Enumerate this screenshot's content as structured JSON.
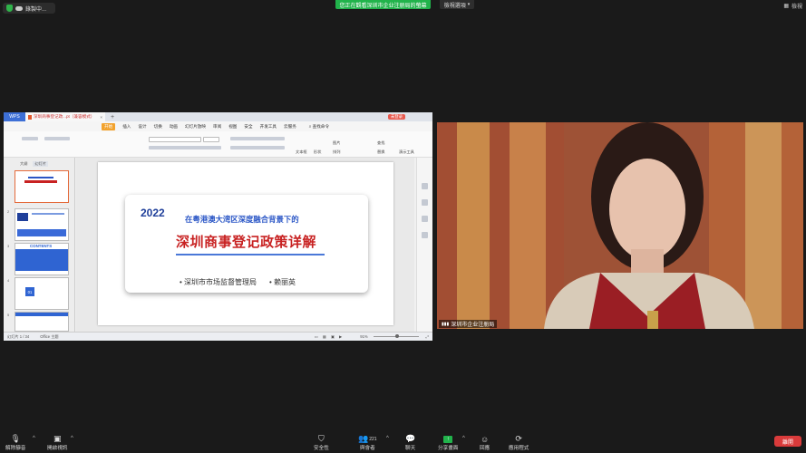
{
  "top": {
    "recording_label": "錄製中...",
    "viewing_label": "您正在觀看深圳市企业注册局的螢幕",
    "view_options_label": "檢視選項",
    "window_label": "檢視"
  },
  "shared_screen": {
    "app_tab": "WPS",
    "doc_tab": "深圳商事登记政...pt（兼容模式）",
    "login_badge": "未登录",
    "menu": [
      "开始",
      "插入",
      "设计",
      "切换",
      "动画",
      "幻灯片放映",
      "审阅",
      "视图",
      "安全",
      "开发工具",
      "云服务"
    ],
    "menu_active_index": 0,
    "search_label": "查找命令",
    "toolbar_labels": {
      "textbox": "文本框",
      "shape": "形状",
      "arrange": "排列",
      "picture": "图片",
      "find": "查找",
      "replace": "替换",
      "presenter": "演示工具"
    },
    "pane_tabs": [
      "大纲",
      "幻灯片"
    ],
    "thumb_labels": [
      "2",
      "3",
      "4",
      "5",
      "6"
    ],
    "thumb_contents": "CONTENTS",
    "thumb_badge": "01",
    "slide": {
      "year": "2022",
      "subtitle": "在粤港澳大湾区深度融合背景下的",
      "title": "深圳商事登记政策详解",
      "org": "深圳市市场监督管理局",
      "author": "赖丽英"
    },
    "status": {
      "slide_counter": "幻灯片 1 / 34",
      "theme": "Office 主题",
      "zoom": "91%"
    }
  },
  "video": {
    "participant_name": "深圳市企业注册局"
  },
  "bottom_bar": {
    "mute": "解除靜音",
    "video": "開啟視訊",
    "security": "安全性",
    "participants": "與會者",
    "participant_count": "221",
    "chat": "聊天",
    "share": "分享畫面",
    "reactions": "回應",
    "apps": "應用程式",
    "end": "離開"
  },
  "colors": {
    "background": "#1a1a1a",
    "viewing_green": "#21b34b",
    "end_red": "#d93b3b",
    "slide_title_red": "#c82222",
    "slide_blue": "#2a56c6"
  }
}
